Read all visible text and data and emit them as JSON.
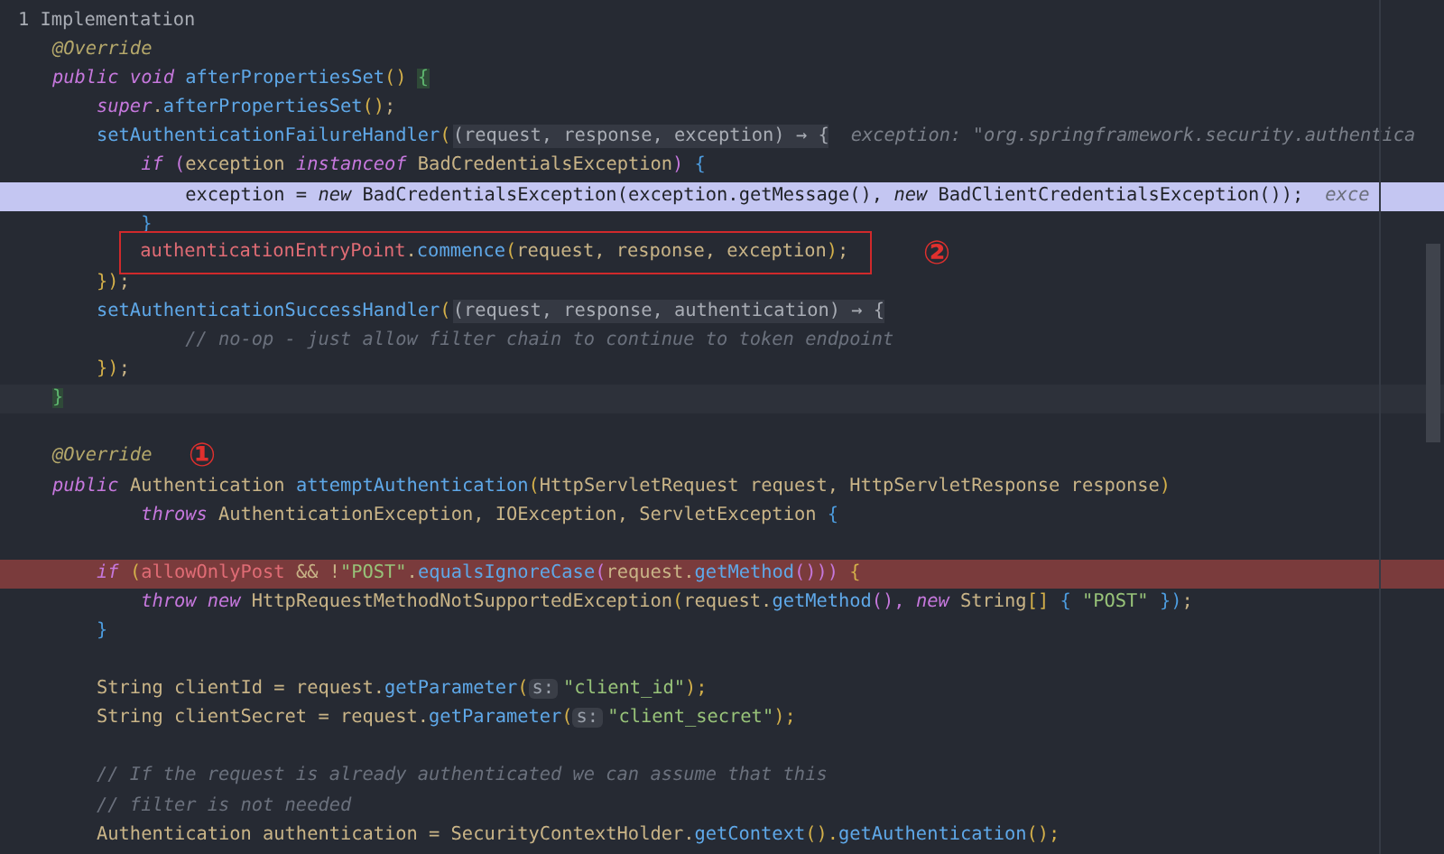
{
  "usages_hint": "1 Implementation",
  "lines": [
    {
      "kind": "code",
      "tokens": [
        {
          "text": "@Override",
          "kind": "ann"
        }
      ]
    },
    {
      "kind": "code",
      "tokens": [
        {
          "text": "public void ",
          "kind": "kw"
        },
        {
          "text": "afterPropertiesSet",
          "kind": "fn"
        },
        {
          "text": "() ",
          "kind": "b1"
        },
        {
          "text": "{",
          "kind": "match"
        }
      ]
    },
    {
      "kind": "code",
      "tokens": [
        {
          "text": "    super",
          "kind": "kw"
        },
        {
          "text": ".",
          "kind": "plain"
        },
        {
          "text": "afterPropertiesSet",
          "kind": "fn"
        },
        {
          "text": "()",
          "kind": "b1"
        },
        {
          "text": ";",
          "kind": "plain"
        }
      ]
    },
    {
      "kind": "code",
      "tokens": [
        {
          "text": "    setAuthenticationFailureHandler",
          "kind": "fn"
        },
        {
          "text": "(",
          "kind": "b1"
        },
        {
          "text": "(request, response, exception) → {",
          "kind": "lambda"
        },
        {
          "text": "exception: \"org.springframework.security.authentica",
          "kind": "hint"
        }
      ]
    },
    {
      "kind": "code",
      "tokens": [
        {
          "text": "        if ",
          "kind": "kw"
        },
        {
          "text": "(",
          "kind": "b2"
        },
        {
          "text": "exception ",
          "kind": "plain"
        },
        {
          "text": "instanceof ",
          "kind": "kw"
        },
        {
          "text": "BadCredentialsException",
          "kind": "plain"
        },
        {
          "text": ") ",
          "kind": "b2"
        },
        {
          "text": "{",
          "kind": "b3"
        }
      ]
    },
    {
      "kind": "selected",
      "tokens": [
        {
          "text": "            exception = ",
          "kind": "plain"
        },
        {
          "text": "new ",
          "kind": "kw"
        },
        {
          "text": "BadCredentialsException",
          "kind": "plain"
        },
        {
          "text": "(",
          "kind": "b1"
        },
        {
          "text": "exception.",
          "kind": "plain"
        },
        {
          "text": "getMessage",
          "kind": "fn"
        },
        {
          "text": "(), ",
          "kind": "b2"
        },
        {
          "text": "new ",
          "kind": "kw"
        },
        {
          "text": "BadClientCredentialsException",
          "kind": "plain"
        },
        {
          "text": "())",
          "kind": "b2"
        },
        {
          "text": ";",
          "kind": "plain"
        },
        {
          "text": "exce",
          "kind": "hint"
        }
      ]
    },
    {
      "kind": "code",
      "tokens": [
        {
          "text": "        }",
          "kind": "b3"
        }
      ]
    },
    {
      "kind": "code",
      "callout": {
        "kind": "box",
        "mark": "②"
      },
      "tokens": [
        {
          "text": "        authenticationEntryPoint",
          "kind": "field"
        },
        {
          "text": ".",
          "kind": "plain"
        },
        {
          "text": "commence",
          "kind": "fn"
        },
        {
          "text": "(",
          "kind": "b1"
        },
        {
          "text": "request, response, exception",
          "kind": "plain"
        },
        {
          "text": ")",
          "kind": "b1"
        },
        {
          "text": ";",
          "kind": "plain"
        }
      ]
    },
    {
      "kind": "code",
      "tokens": [
        {
          "text": "    })",
          "kind": "b1"
        },
        {
          "text": ";",
          "kind": "plain"
        }
      ]
    },
    {
      "kind": "code",
      "tokens": [
        {
          "text": "    setAuthenticationSuccessHandler",
          "kind": "fn"
        },
        {
          "text": "(",
          "kind": "b1"
        },
        {
          "text": "(request, response, authentication) → {",
          "kind": "lambda"
        }
      ]
    },
    {
      "kind": "code",
      "tokens": [
        {
          "text": "            // no-op - just allow filter chain to continue to token endpoint",
          "kind": "cm"
        }
      ]
    },
    {
      "kind": "code",
      "tokens": [
        {
          "text": "    })",
          "kind": "b1"
        },
        {
          "text": ";",
          "kind": "plain"
        }
      ]
    },
    {
      "kind": "caret",
      "tokens": [
        {
          "text": "}",
          "kind": "match"
        }
      ]
    },
    {
      "kind": "blank"
    },
    {
      "kind": "code",
      "callout": {
        "kind": "plain",
        "mark": "①"
      },
      "tokens": [
        {
          "text": "@Override",
          "kind": "ann"
        }
      ]
    },
    {
      "kind": "code",
      "tokens": [
        {
          "text": "public ",
          "kind": "kw"
        },
        {
          "text": "Authentication ",
          "kind": "plain"
        },
        {
          "text": "attemptAuthentication",
          "kind": "fn"
        },
        {
          "text": "(",
          "kind": "b1"
        },
        {
          "text": "HttpServletRequest request, HttpServletResponse response",
          "kind": "plain"
        },
        {
          "text": ")",
          "kind": "b1"
        }
      ]
    },
    {
      "kind": "code",
      "tokens": [
        {
          "text": "        throws ",
          "kind": "kw"
        },
        {
          "text": "AuthenticationException, IOException, ServletException ",
          "kind": "plain"
        },
        {
          "text": "{",
          "kind": "b3"
        }
      ]
    },
    {
      "kind": "blank"
    },
    {
      "kind": "error",
      "tokens": [
        {
          "text": "    if ",
          "kind": "kw"
        },
        {
          "text": "(",
          "kind": "b1"
        },
        {
          "text": "allowOnlyPost",
          "kind": "field"
        },
        {
          "text": " && !",
          "kind": "plain"
        },
        {
          "text": "\"POST\"",
          "kind": "str"
        },
        {
          "text": ".",
          "kind": "plain"
        },
        {
          "text": "equalsIgnoreCase",
          "kind": "fn"
        },
        {
          "text": "(",
          "kind": "b2"
        },
        {
          "text": "request.",
          "kind": "plain"
        },
        {
          "text": "getMethod",
          "kind": "fn"
        },
        {
          "text": "()))",
          "kind": "b2"
        },
        {
          "text": " {",
          "kind": "b1"
        }
      ]
    },
    {
      "kind": "code",
      "tokens": [
        {
          "text": "        throw new ",
          "kind": "kw"
        },
        {
          "text": "HttpRequestMethodNotSupportedException",
          "kind": "plain"
        },
        {
          "text": "(",
          "kind": "b1"
        },
        {
          "text": "request.",
          "kind": "plain"
        },
        {
          "text": "getMethod",
          "kind": "fn"
        },
        {
          "text": "(), ",
          "kind": "b2"
        },
        {
          "text": "new ",
          "kind": "kw"
        },
        {
          "text": "String",
          "kind": "plain"
        },
        {
          "text": "[] ",
          "kind": "b1"
        },
        {
          "text": "{ ",
          "kind": "b3"
        },
        {
          "text": "\"POST\"",
          "kind": "str"
        },
        {
          "text": " })",
          "kind": "b3"
        },
        {
          "text": ";",
          "kind": "plain"
        }
      ]
    },
    {
      "kind": "code",
      "tokens": [
        {
          "text": "    }",
          "kind": "b3"
        }
      ]
    },
    {
      "kind": "blank"
    },
    {
      "kind": "code",
      "tokens": [
        {
          "text": "    String clientId = request.",
          "kind": "plain"
        },
        {
          "text": "getParameter",
          "kind": "fn"
        },
        {
          "text": "(",
          "kind": "b1"
        },
        {
          "text": "s:",
          "kind": "param"
        },
        {
          "text": "\"client_id\"",
          "kind": "str"
        },
        {
          "text": ");",
          "kind": "b1"
        }
      ]
    },
    {
      "kind": "code",
      "tokens": [
        {
          "text": "    String clientSecret = request.",
          "kind": "plain"
        },
        {
          "text": "getParameter",
          "kind": "fn"
        },
        {
          "text": "(",
          "kind": "b1"
        },
        {
          "text": "s:",
          "kind": "param"
        },
        {
          "text": "\"client_secret\"",
          "kind": "str"
        },
        {
          "text": ");",
          "kind": "b1"
        }
      ]
    },
    {
      "kind": "blank"
    },
    {
      "kind": "code",
      "tokens": [
        {
          "text": "    // If the request is already authenticated we can assume that this",
          "kind": "cm"
        }
      ]
    },
    {
      "kind": "code",
      "tokens": [
        {
          "text": "    // filter is not needed",
          "kind": "cm"
        }
      ]
    },
    {
      "kind": "code",
      "tokens": [
        {
          "text": "    Authentication authentication = SecurityContextHolder.",
          "kind": "plain"
        },
        {
          "text": "getContext",
          "kind": "fn"
        },
        {
          "text": "().",
          "kind": "b1"
        },
        {
          "text": "getAuthentication",
          "kind": "fn"
        },
        {
          "text": "();",
          "kind": "b1"
        }
      ]
    }
  ]
}
